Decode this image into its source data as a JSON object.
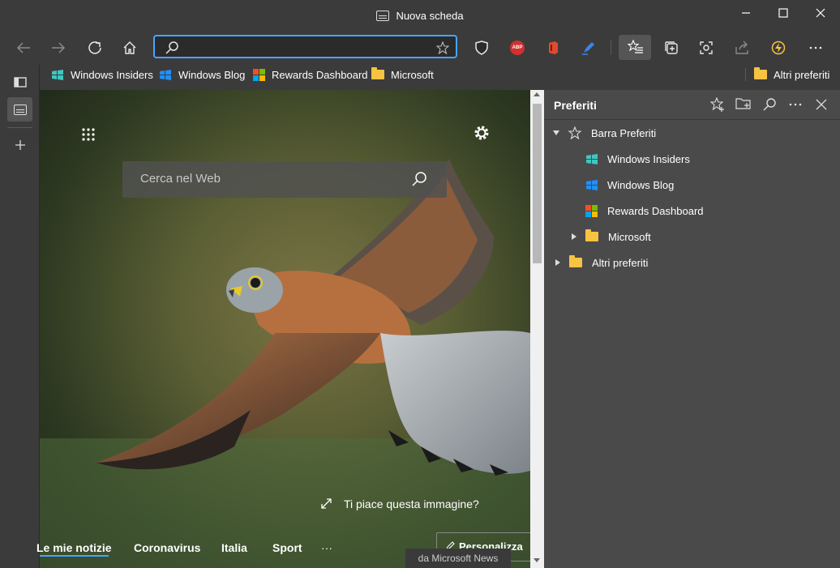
{
  "window": {
    "title": "Nuova scheda"
  },
  "address": {
    "value": "",
    "placeholder": ""
  },
  "favorites_bar": {
    "items": [
      {
        "label": "Windows Insiders",
        "icon": "windows-insider-icon"
      },
      {
        "label": "Windows Blog",
        "icon": "windows-logo-icon"
      },
      {
        "label": "Rewards Dashboard",
        "icon": "microsoft-logo-icon"
      },
      {
        "label": "Microsoft",
        "icon": "folder-icon"
      }
    ],
    "other": "Altri preferiti"
  },
  "extensions": {
    "abp_label": "ABP"
  },
  "newtab": {
    "search_placeholder": "Cerca nel Web",
    "image_prompt": "Ti piace questa immagine?",
    "news_tabs": [
      "Le mie notizie",
      "Coronavirus",
      "Italia",
      "Sport"
    ],
    "more": "···",
    "personalize": "Personalizza",
    "news_source": "da Microsoft News"
  },
  "panel": {
    "title": "Preferiti",
    "tree": {
      "root": "Barra Preferiti",
      "children": [
        "Windows Insiders",
        "Windows Blog",
        "Rewards Dashboard",
        "Microsoft"
      ],
      "other": "Altri preferiti"
    }
  },
  "colors": {
    "accent": "#4aa3ff",
    "folder": "#f6c343",
    "panel_bg": "#4a4a4a",
    "chrome_bg": "#3b3b3b"
  }
}
